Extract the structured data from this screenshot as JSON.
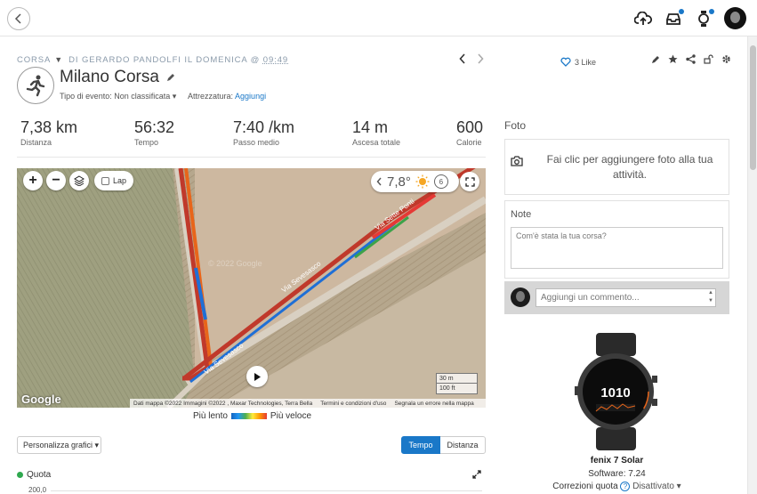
{
  "header": {
    "breadcrumb_type": "CORSA",
    "breadcrumb_author": "DI GERARDO PANDOLFI IL DOMENICA @",
    "breadcrumb_time": "09:49",
    "title": "Milano Corsa",
    "event_type": "Tipo di evento: Non classificata ▾",
    "equipment_label": "Attrezzatura:",
    "equipment_link": "Aggiungi",
    "likes": "3 Like"
  },
  "stats": [
    {
      "value": "7,38 km",
      "label": "Distanza"
    },
    {
      "value": "56:32",
      "label": "Tempo"
    },
    {
      "value": "7:40 /km",
      "label": "Passo medio"
    },
    {
      "value": "14 m",
      "label": "Ascesa totale"
    },
    {
      "value": "600",
      "label": "Calorie"
    }
  ],
  "map": {
    "lap_label": "Lap",
    "temperature": "7,8°",
    "wind": "6",
    "watermark": "© 2022 Google",
    "street_1": "Via Sette Ponti",
    "street_2": "Via Sevesasco",
    "street_3": "Via Sevesasco",
    "google": "Google",
    "scale_m": "30 m",
    "scale_ft": "100 ft",
    "footer_data": "Dati mappa ©2022 Immagini ©2022 , Maxar Technologies, Terra Bella",
    "footer_terms": "Termini e condizioni d'uso",
    "footer_report": "Segnala un errore nella mappa"
  },
  "legend": {
    "slow": "Più lento",
    "fast": "Più veloce"
  },
  "charts": {
    "customize": "Personalizza grafici ▾",
    "toggle_time": "Tempo",
    "toggle_distance": "Distanza",
    "quota_label": "Quota",
    "quota_color": "#2fa84f",
    "ytick": "200,0"
  },
  "sidebar": {
    "photo_title": "Foto",
    "photo_prompt": "Fai clic per aggiungere foto alla tua attività.",
    "notes_title": "Note",
    "notes_placeholder": "Com'è stata la tua corsa?",
    "comment_placeholder": "Aggiungi un commento...",
    "device_name": "fenix 7 Solar",
    "software": "Software: 7.24",
    "corrections_label": "Correzioni quota",
    "corrections_value": "Disattivato ▾",
    "watch_time": "1010"
  },
  "colors": {
    "accent": "#1a78c8",
    "notification_dot": "#1a78c8"
  }
}
